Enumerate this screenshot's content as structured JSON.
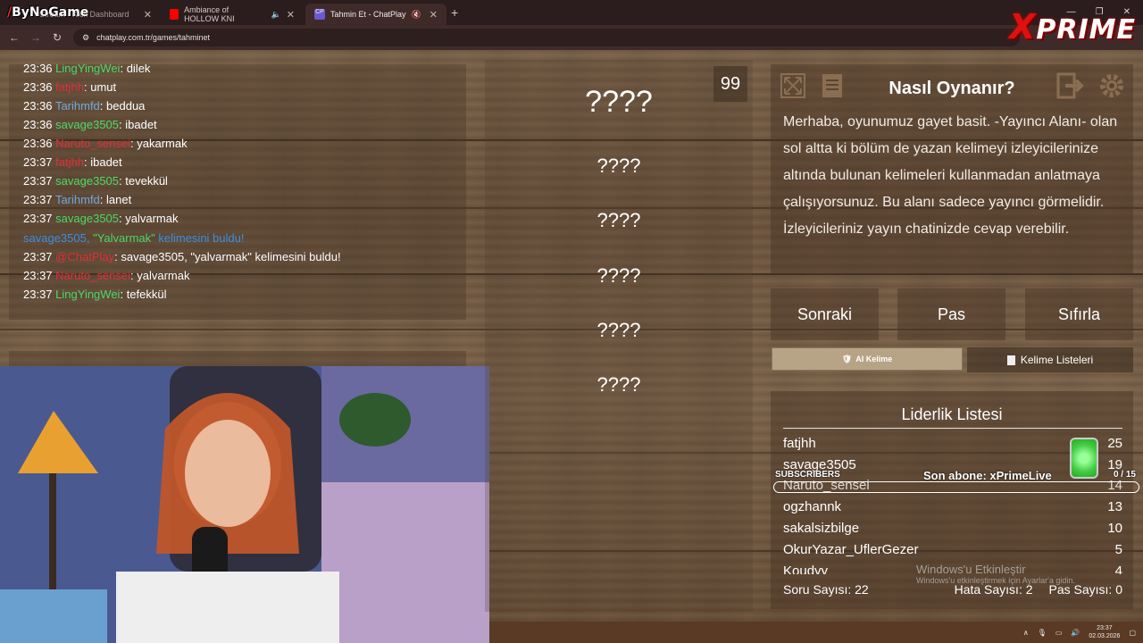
{
  "browser": {
    "tabs": [
      {
        "title": "Stream - Kick Dashboard",
        "color": "#53fc18"
      },
      {
        "title": "Ambiance of HOLLOW KNI",
        "color": "#ff0000"
      },
      {
        "title": "Tahmin Et - ChatPlay",
        "color": "#6a5acd"
      }
    ],
    "url": "chatplay.com.tr/games/tahminet",
    "logo": "ByNoGame",
    "brand": "PRIME",
    "brand_x": "X"
  },
  "chat": {
    "messages": [
      {
        "time": "23:36",
        "user": "LingYingWei",
        "color": "#4cd964",
        "text": "dilek"
      },
      {
        "time": "23:36",
        "user": "fatjhh",
        "color": "#e0303a",
        "text": "umut"
      },
      {
        "time": "23:36",
        "user": "Tarihmfd",
        "color": "#6fa8dc",
        "text": "beddua"
      },
      {
        "time": "23:36",
        "user": "savage3505",
        "color": "#4cd964",
        "text": "ibadet"
      },
      {
        "time": "23:36",
        "user": "Naruto_sensei",
        "color": "#e0303a",
        "text": "yakarmak"
      },
      {
        "time": "23:37",
        "user": "fatjhh",
        "color": "#e0303a",
        "text": "ibadet"
      },
      {
        "time": "23:37",
        "user": "savage3505",
        "color": "#4cd964",
        "text": "tevekkül"
      },
      {
        "time": "23:37",
        "user": "Tarihmfd",
        "color": "#6fa8dc",
        "text": "lanet"
      },
      {
        "time": "23:37",
        "user": "savage3505",
        "color": "#4cd964",
        "text": "yalvarmak"
      }
    ],
    "system": {
      "user": "savage3505,",
      "word": "\"Yalvarmak\"",
      "rest": "kelimesini buldu!"
    },
    "bot": {
      "time": "23:37",
      "user": "@ChatPlay",
      "text": "savage3505, \"yalvarmak\" kelimesini buldu!"
    },
    "after": [
      {
        "time": "23:37",
        "user": "Naruto_sensei",
        "color": "#e0303a",
        "text": "yalvarmak"
      },
      {
        "time": "23:37",
        "user": "LingYingWei",
        "color": "#4cd964",
        "text": "tefekkül"
      }
    ]
  },
  "game": {
    "words": [
      "????",
      "????",
      "????",
      "????",
      "????",
      "????"
    ],
    "counter": "99",
    "howto_title": "Nasıl Oynanır?",
    "howto_text": "Merhaba, oyunumuz gayet basit. -Yayıncı Alanı- olan sol altta ki bölüm de yazan kelimeyi izleyicilerinize altında bulunan kelimeleri kullanmadan anlatmaya çalışıyorsunuz. Bu alanı sadece yayıncı görmelidir. İzleyicileriniz yayın chatinizde cevap verebilir.",
    "buttons": {
      "next": "Sonraki",
      "pass": "Pas",
      "reset": "Sıfırla"
    },
    "ai_label": "AI Kelime",
    "lists_label": "Kelime Listeleri"
  },
  "leaderboard": {
    "title": "Liderlik Listesi",
    "rows": [
      {
        "name": "fatjhh",
        "score": "25"
      },
      {
        "name": "savage3505",
        "score": "19"
      },
      {
        "name": "Naruto_sensei",
        "score": "14"
      },
      {
        "name": "ogzhannk",
        "score": "13"
      },
      {
        "name": "sakalsizbilge",
        "score": "10"
      },
      {
        "name": "OkurYazar_UflerGezer",
        "score": "5"
      },
      {
        "name": "Koudyy",
        "score": "4"
      }
    ],
    "questions": "Soru Sayısı: 22",
    "errors": "Hata Sayısı: 2",
    "passes": "Pas Sayısı: 0"
  },
  "overlay": {
    "subscribers_label": "SUBSCRIBERS",
    "last_sub": "Son abone: xPrimeLive",
    "count": "0 / 15",
    "progress": 0
  },
  "watermark": {
    "title": "Windows'u Etkinleştir",
    "sub": "Windows'u etkinleştirmek için Ayarlar'a gidin."
  },
  "taskbar": {
    "time": "23:37",
    "date": "02.03.2026"
  }
}
